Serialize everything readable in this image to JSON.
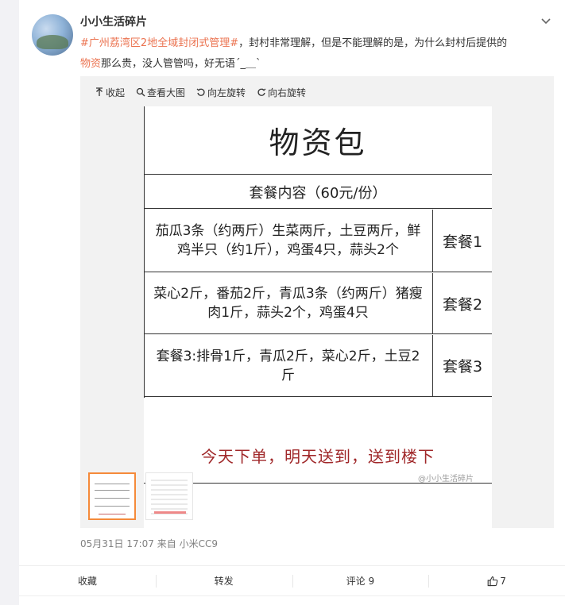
{
  "post": {
    "username": "小小生活碎片",
    "topic": "#广州",
    "highlight_place": "荔湾区",
    "topic_tail": "2地全域封闭式管理#",
    "text_part1": "，封村非常理解，但是不能理解的是，为什么封村后提供的",
    "highlight_goods": "物资",
    "text_part2": "那么贵，没人管管吗，好无语ˊ_＿ˋ"
  },
  "viewer": {
    "collapse_label": "收起",
    "view_large_label": "查看大图",
    "rotate_left_label": "向左旋转",
    "rotate_right_label": "向右旋转"
  },
  "image": {
    "title": "物资包",
    "subtitle": "套餐内容（60元/份）",
    "packages": [
      {
        "desc": "茄瓜3条（约两斤）生菜两斤，土豆两斤，鲜鸡半只（约1斤），鸡蛋4只，蒜头2个",
        "name": "套餐1"
      },
      {
        "desc": "菜心2斤，番茄2斤，青瓜3条（约两斤）猪瘦肉1斤，蒜头2个，鸡蛋4只",
        "name": "套餐2"
      },
      {
        "desc": "套餐3:排骨1斤，青瓜2斤，菜心2斤，土豆2斤",
        "name": "套餐3"
      }
    ],
    "promo": "今天下单，明天送到，送到楼下",
    "watermark": "@小小生活碎片"
  },
  "meta": {
    "datetime": "05月31日 17:07",
    "source_prefix": "来自",
    "source": "小米CC9"
  },
  "actions": {
    "favorite_label": "收藏",
    "repost_label": "转发",
    "comment_label": "评论 9",
    "like_count": "7"
  },
  "colors": {
    "link": "#eb7350",
    "promo": "#a0282a",
    "thumb_selected_border": "#f58a3a"
  }
}
